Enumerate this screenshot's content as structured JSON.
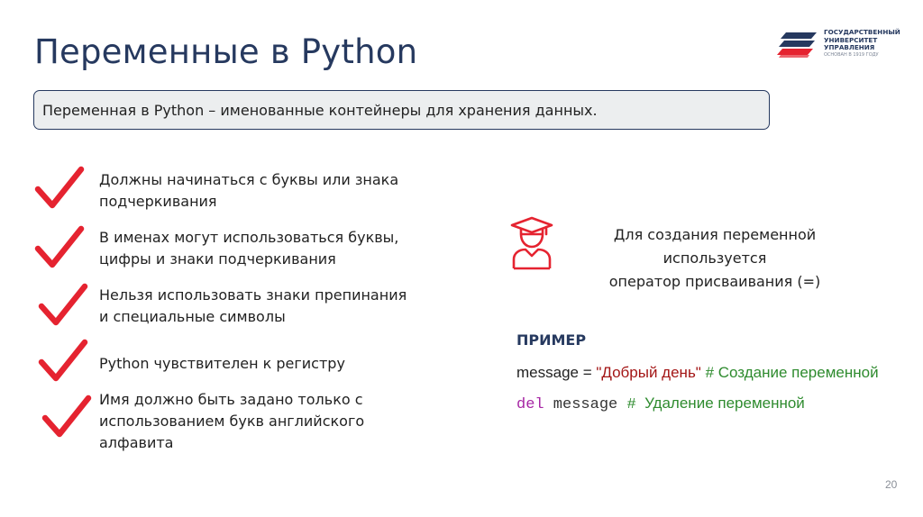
{
  "title": "Переменные в Python",
  "logo": {
    "line1": "ГОСУДАРСТВЕННЫЙ",
    "line2": "УНИВЕРСИТЕТ",
    "line3": "УПРАВЛЕНИЯ",
    "subtitle": "ОСНОВАН В 1919 ГОДУ"
  },
  "definition": "Переменная в Python – именованные контейнеры для хранения данных.",
  "rules": [
    {
      "line1": "Должны начинаться с буквы или знака",
      "line2": "подчеркивания"
    },
    {
      "line1": "В именах могут использоваться буквы,",
      "line2": "цифры и знаки подчеркивания"
    },
    {
      "line1": "Нельзя использовать знаки препинания",
      "line2": "и специальные символы"
    },
    {
      "line1": "Python чувствителен к регистру",
      "line2": ""
    },
    {
      "line1": "Имя должно быть задано только с",
      "line2": "использованием букв английского алфавита"
    }
  ],
  "note": {
    "line1": "Для создания переменной используется",
    "line2": "оператор присваивания (=)"
  },
  "example": {
    "title": "ПРИМЕР",
    "code1": {
      "var": "message",
      "op": " = ",
      "string": "\"Добрый день\"",
      "comment": " # Создание переменной"
    },
    "code2": {
      "keyword": "del",
      "var": " message ",
      "hash": "#",
      "comment": "  Удаление переменной"
    }
  },
  "page_number": "20",
  "colors": {
    "title": "#26395f",
    "check": "#e52330",
    "string": "#a31515",
    "comment": "#2e8b2e",
    "keyword": "#a626a4"
  },
  "icons": {
    "check": "check-mark-icon",
    "student": "graduate-student-icon",
    "logo": "university-logo-icon"
  }
}
